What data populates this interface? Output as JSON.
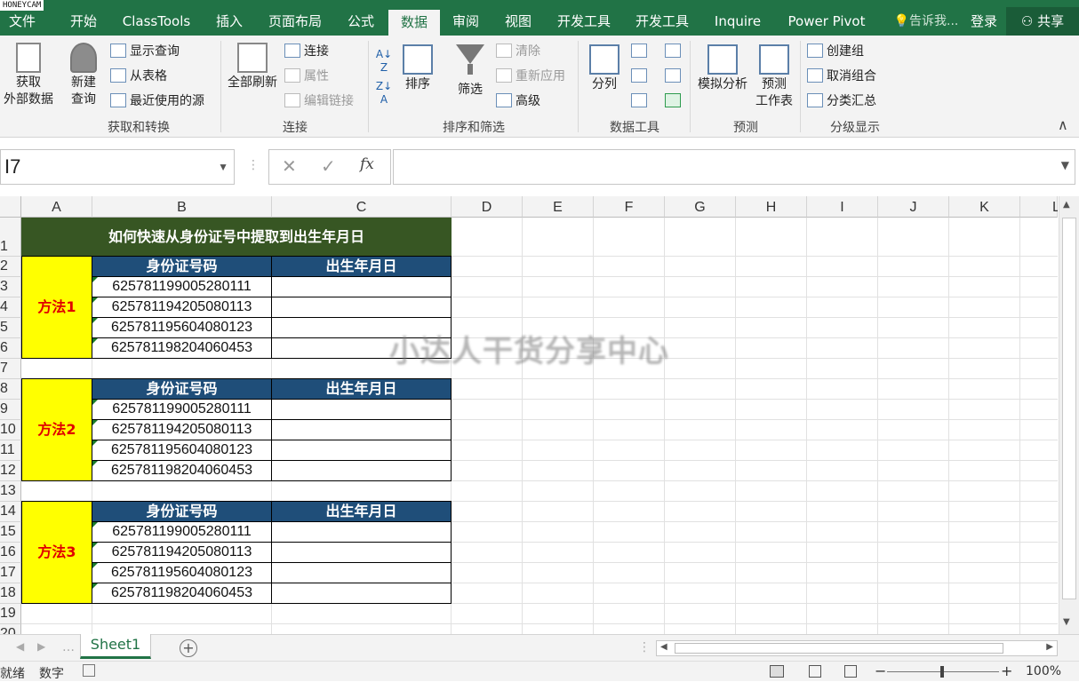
{
  "watermark_top": "HONEYCAM",
  "tabs": [
    "文件",
    "开始",
    "ClassTools",
    "插入",
    "页面布局",
    "公式",
    "数据",
    "审阅",
    "视图",
    "开发工具",
    "开发工具",
    "Inquire",
    "Power Pivot"
  ],
  "active_tab": "数据",
  "tell_me": "告诉我...",
  "login": "登录",
  "share": "共享",
  "ribbon": {
    "get_external": [
      "获取",
      "外部数据"
    ],
    "new_query": [
      "新建",
      "查询"
    ],
    "show_query": "显示查询",
    "from_table": "从表格",
    "recent_sources": "最近使用的源",
    "group_get_transform": "获取和转换",
    "refresh_all": "全部刷新",
    "connections": "连接",
    "properties": "属性",
    "edit_links": "编辑链接",
    "group_connections": "连接",
    "sort": "排序",
    "filter": "筛选",
    "clear": "清除",
    "reapply": "重新应用",
    "advanced": "高级",
    "group_sort_filter": "排序和筛选",
    "text_to_columns": "分列",
    "group_data_tools": "数据工具",
    "what_if": "模拟分析",
    "forecast_sheet": [
      "预测",
      "工作表"
    ],
    "group_forecast": "预测",
    "group_item": "创建组",
    "ungroup": "取消组合",
    "subtotal": "分类汇总",
    "group_outline": "分级显示"
  },
  "formula_bar": {
    "name_box": "I7",
    "formula": ""
  },
  "columns": [
    "A",
    "B",
    "C",
    "D",
    "E",
    "F",
    "G",
    "H",
    "I",
    "J",
    "K",
    "L"
  ],
  "rows": [
    "1",
    "2",
    "3",
    "4",
    "5",
    "6",
    "7",
    "8",
    "9",
    "10",
    "11",
    "12",
    "13",
    "14",
    "15",
    "16",
    "17",
    "18",
    "19",
    "20"
  ],
  "sheet": {
    "title": "如何快速从身份证号中提取到出生年月日",
    "header_id": "身份证号码",
    "header_birth": "出生年月日",
    "methods": [
      "方法1",
      "方法2",
      "方法3"
    ],
    "ids": [
      "625781199005280111",
      "625781194205080113",
      "625781195604080123",
      "625781198204060453"
    ]
  },
  "watermark": "小达人干货分享中心",
  "sheet_tab": "Sheet1",
  "status": {
    "ready": "就绪",
    "mode": "数字",
    "zoom": "100%"
  }
}
